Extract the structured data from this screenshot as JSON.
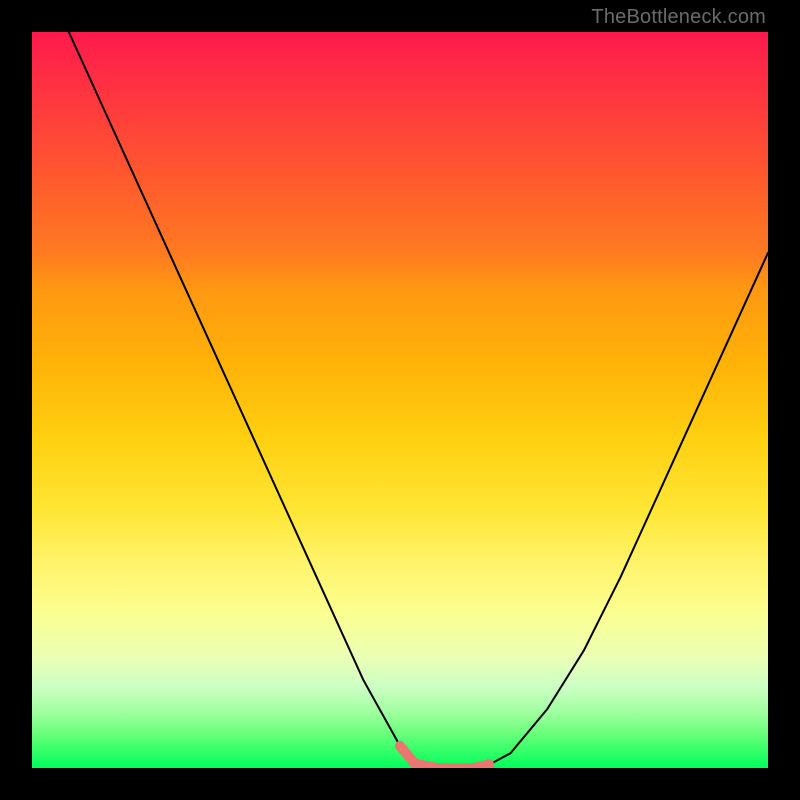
{
  "watermark": "TheBottleneck.com",
  "colors": {
    "frame": "#000000",
    "curve_black": "#000000",
    "highlight": "#e9766f",
    "gradient_top": "#ff1a4d",
    "gradient_bottom": "#00ff5a"
  },
  "chart_data": {
    "type": "line",
    "title": "",
    "xlabel": "",
    "ylabel": "",
    "xlim": [
      0,
      100
    ],
    "ylim": [
      0,
      100
    ],
    "grid": false,
    "legend": false,
    "note": "No axes, tick labels, or data labels are rendered in the image; values are estimated from curve geometry within the gradient plot area.",
    "series": [
      {
        "name": "curve",
        "x": [
          5,
          10,
          15,
          20,
          25,
          30,
          35,
          40,
          45,
          50,
          52,
          55,
          58,
          60,
          62,
          65,
          70,
          75,
          80,
          85,
          90,
          95,
          100
        ],
        "y": [
          100,
          89,
          78,
          67,
          56,
          45,
          34,
          23,
          12,
          3,
          0.6,
          0,
          0,
          0,
          0.4,
          2,
          8,
          16,
          26,
          37,
          48,
          59,
          70
        ]
      }
    ],
    "highlight_segment": {
      "name": "bottom-flat",
      "x": [
        50,
        52,
        55,
        58,
        60,
        62
      ],
      "y": [
        3,
        0.6,
        0,
        0,
        0,
        0.4
      ]
    }
  }
}
